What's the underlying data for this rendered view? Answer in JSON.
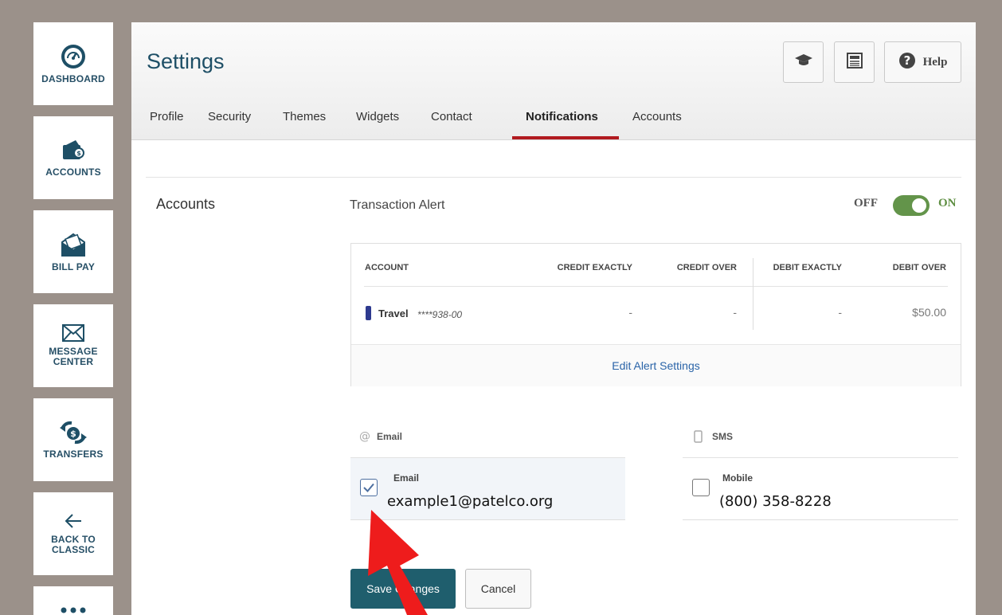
{
  "sidebar": {
    "items": [
      {
        "label": "DASHBOARD",
        "icon": "dashboard-gauge-icon"
      },
      {
        "label": "ACCOUNTS",
        "icon": "wallet-icon"
      },
      {
        "label": "BILL PAY",
        "icon": "bill-envelope-icon"
      },
      {
        "label_lines": [
          "MESSAGE",
          "CENTER"
        ],
        "icon": "envelope-icon"
      },
      {
        "label": "TRANSFERS",
        "icon": "transfer-dollar-icon"
      },
      {
        "label_lines": [
          "BACK TO",
          "CLASSIC"
        ],
        "icon": "arrow-left-icon"
      },
      {
        "label": "",
        "icon": "more-dots-icon"
      }
    ]
  },
  "header": {
    "title": "Settings",
    "help_label": "Help",
    "icons": [
      "graduation-cap-icon",
      "newspaper-icon",
      "help-circle-icon"
    ]
  },
  "tabs": [
    "Profile",
    "Security",
    "Themes",
    "Widgets",
    "Contact",
    "Notifications",
    "Accounts"
  ],
  "active_tab": "Notifications",
  "section": {
    "heading": "Accounts",
    "alert_title": "Transaction Alert",
    "toggle_off_label": "OFF",
    "toggle_on_label": "ON",
    "toggle_state": "on"
  },
  "alert_table": {
    "columns": [
      "ACCOUNT",
      "CREDIT EXACTLY",
      "CREDIT OVER",
      "DEBIT EXACTLY",
      "DEBIT OVER"
    ],
    "rows": [
      {
        "name": "Travel",
        "number": "****938-00",
        "credit_exactly": "-",
        "credit_over": "-",
        "debit_exactly": "-",
        "debit_over": "$50.00"
      }
    ],
    "edit_link": "Edit Alert Settings"
  },
  "contact": {
    "email_header": "Email",
    "email_field_label": "Email",
    "email_value": "example1@patelco.org",
    "email_checked": true,
    "sms_header": "SMS",
    "mobile_label": "Mobile",
    "mobile_value": "(800) 358-8228",
    "mobile_checked": false
  },
  "buttons": {
    "save": "Save Changes",
    "cancel": "Cancel"
  },
  "colors": {
    "brand_teal": "#1f5e6d",
    "tab_underline": "#b11a1f",
    "toggle_on": "#63944a",
    "annotation_arrow": "#ee1c1c"
  }
}
